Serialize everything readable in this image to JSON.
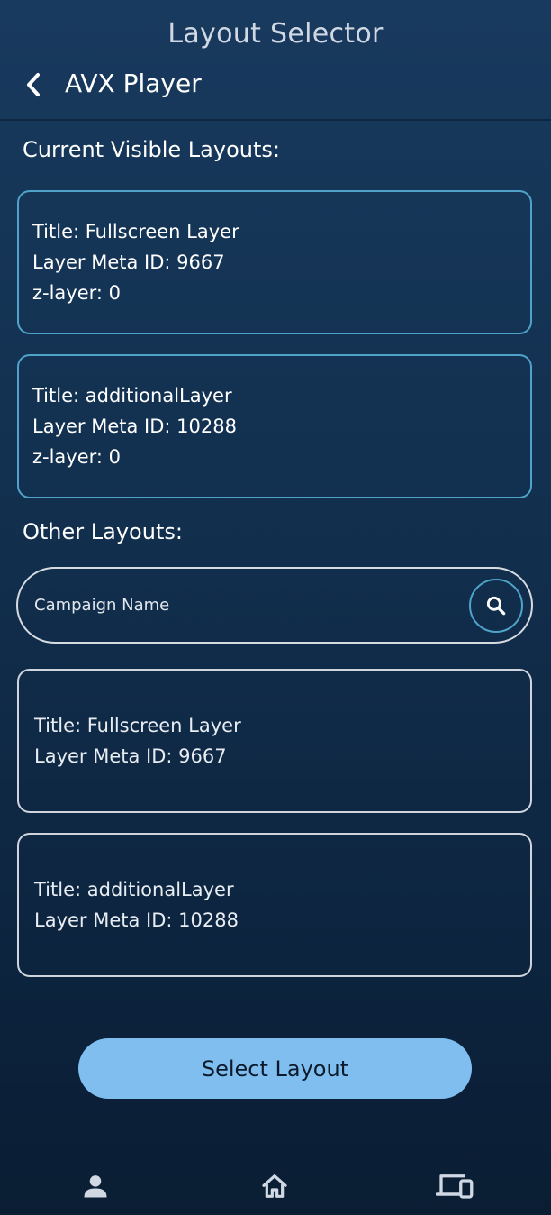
{
  "header": {
    "title": "Layout Selector",
    "subtitle": "AVX Player",
    "back_icon": "chevron-left-icon"
  },
  "visible_section": {
    "title": "Current Visible Layouts:",
    "layouts": [
      {
        "title": "Title: Fullscreen Layer",
        "meta_id": "Layer Meta ID: 9667",
        "z_layer": "z-layer: 0"
      },
      {
        "title": "Title: additionalLayer",
        "meta_id": "Layer Meta ID: 10288",
        "z_layer": "z-layer: 0"
      }
    ]
  },
  "other_section": {
    "title": "Other Layouts:",
    "search": {
      "placeholder": "Campaign Name",
      "value": "",
      "icon": "search-icon"
    },
    "layouts": [
      {
        "title": "Title: Fullscreen Layer",
        "meta_id": "Layer Meta ID: 9667"
      },
      {
        "title": "Title: additionalLayer",
        "meta_id": "Layer Meta ID: 10288"
      }
    ]
  },
  "select_button": {
    "label": "Select Layout"
  },
  "bottom_nav": {
    "items": [
      {
        "icon": "person-icon"
      },
      {
        "icon": "home-icon"
      },
      {
        "icon": "devices-icon"
      }
    ]
  },
  "colors": {
    "background_top": "#183a5e",
    "background_bottom": "#0a1d33",
    "visible_card_border": "#4fa3c9",
    "other_card_border": "#cfd5dc",
    "accent_button": "#80bef0"
  }
}
